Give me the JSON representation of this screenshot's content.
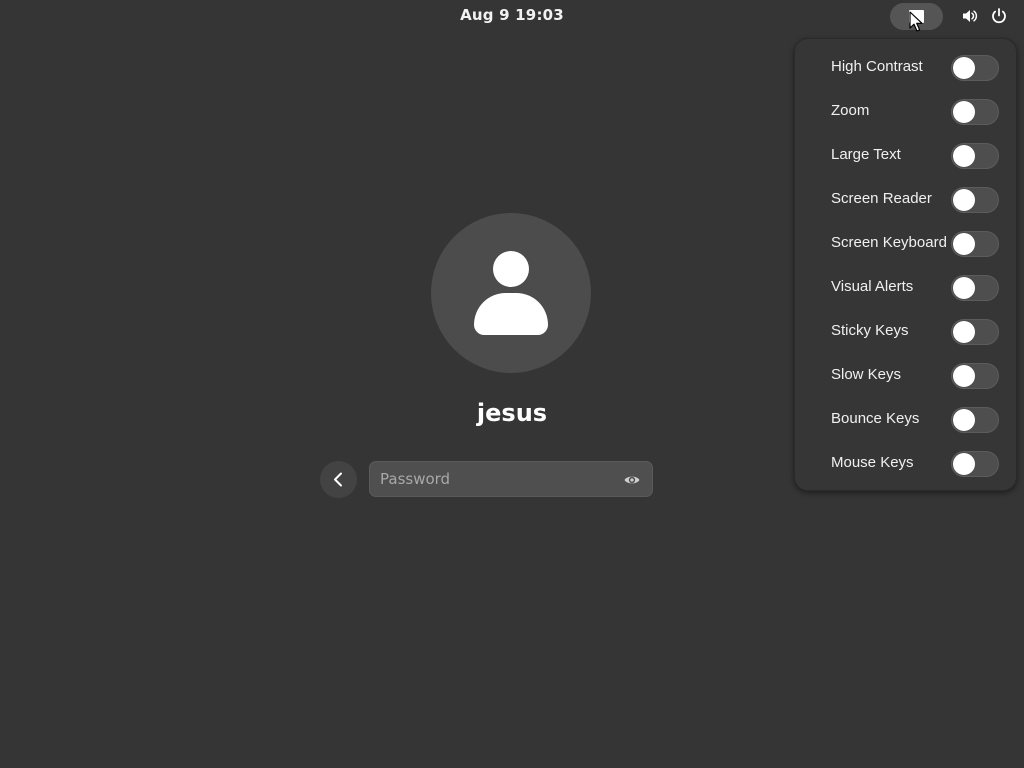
{
  "topbar": {
    "clock": "Aug 9  19:03",
    "tray": [
      {
        "icon": "accessibility-icon"
      },
      {
        "icon": "volume-icon"
      },
      {
        "icon": "power-icon"
      }
    ]
  },
  "login": {
    "avatar_icon": "user-avatar-icon",
    "username": "jesus",
    "back_icon": "chevron-left-icon",
    "password_placeholder": "Password",
    "password_value": "",
    "reveal_icon": "eye-icon"
  },
  "accessibility_menu": {
    "items": [
      {
        "label": "High Contrast",
        "enabled": false
      },
      {
        "label": "Zoom",
        "enabled": false
      },
      {
        "label": "Large Text",
        "enabled": false
      },
      {
        "label": "Screen Reader",
        "enabled": false
      },
      {
        "label": "Screen Keyboard",
        "enabled": false
      },
      {
        "label": "Visual Alerts",
        "enabled": false
      },
      {
        "label": "Sticky Keys",
        "enabled": false
      },
      {
        "label": "Slow Keys",
        "enabled": false
      },
      {
        "label": "Bounce Keys",
        "enabled": false
      },
      {
        "label": "Mouse Keys",
        "enabled": false
      }
    ]
  },
  "colors": {
    "background": "#353535",
    "menu_background": "#363636",
    "switch_off": "#4e4e4e",
    "switch_on": "#3584e4",
    "text": "#ffffff"
  }
}
